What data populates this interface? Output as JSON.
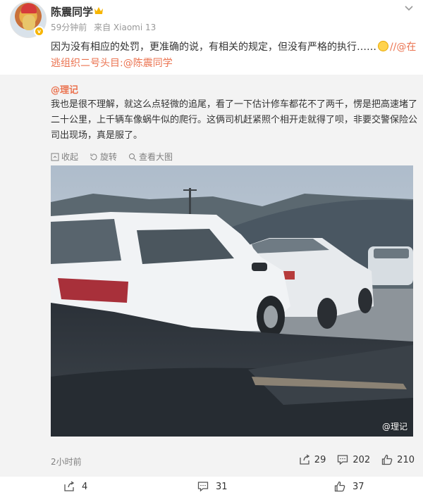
{
  "post": {
    "author": "陈震同学",
    "time": "59分钟前",
    "source": "来自 Xiaomi 13",
    "text": "因为没有相应的处罚，更准确的说，有相关的规定，但没有严格的执行……",
    "mention_tail": "//@在逃组织二号头目:@陈震同学"
  },
  "retweet": {
    "author": "@理记",
    "text": "我也是很不理解，就这么点轻微的追尾，看了一下估计修车都花不了两千，愣是把高速堵了二十公里，上千辆车像蜗牛似的爬行。这俩司机赶紧照个相开走就得了呗，非要交警保险公司出现场，真是服了。",
    "tools": {
      "collect": "收起",
      "rotate": "旋转",
      "view_large": "查看大图"
    },
    "watermark": "@理记",
    "time": "2小时前",
    "stats": {
      "reposts": "29",
      "comments": "202",
      "likes": "210"
    }
  },
  "actions": {
    "reposts": "4",
    "comments": "31",
    "likes": "37"
  },
  "colors": {
    "link": "#eb7350",
    "retweet_bg": "#f3f3f3",
    "meta": "#999999"
  }
}
